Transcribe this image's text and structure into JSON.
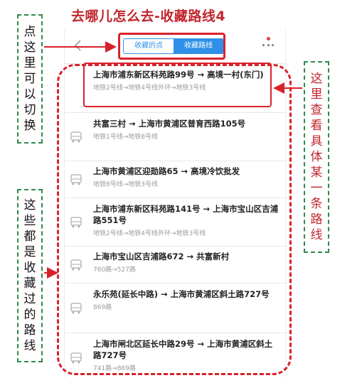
{
  "page_title": "去哪儿怎么去-收藏路线4",
  "header": {
    "tabs": [
      {
        "label": "收藏的点"
      },
      {
        "label": "收藏路线"
      }
    ]
  },
  "routes": [
    {
      "title": "上海市浦东新区科苑路99号 → 高境一村(东门)",
      "sub": "地铁2号线→地铁4号线外环→地铁3号线"
    },
    {
      "title": "共富三村 → 上海市黄浦区普育西路105号",
      "sub": "地铁1号线→地铁8号线"
    },
    {
      "title": "上海市黄浦区迎勋路65 → 高境冷饮批发",
      "sub": "地铁8号线→地铁3号线"
    },
    {
      "title": "上海市浦东新区科苑路141号 → 上海市宝山区吉浦路551号",
      "sub": "地铁2号线→地铁4号线外环→地铁3号线"
    },
    {
      "title": "上海市宝山区吉浦路672 → 共富新村",
      "sub": "760路→527路"
    },
    {
      "title": "永乐苑(延长中路) → 上海市黄浦区斜土路727号",
      "sub": "869路"
    },
    {
      "title": "上海市闸北区延长中路29号 → 上海市黄浦区斜土路727号",
      "sub": "741路→869路"
    }
  ],
  "annotations": {
    "left_top": "点这里可以切换",
    "left_bottom": "这些都是收藏过的路线",
    "right": "这里查看具体某一条路线"
  },
  "colors": {
    "accent_blue": "#2e90e8",
    "highlight_red": "#d8222a",
    "annotation_green": "#2f8a4a"
  }
}
